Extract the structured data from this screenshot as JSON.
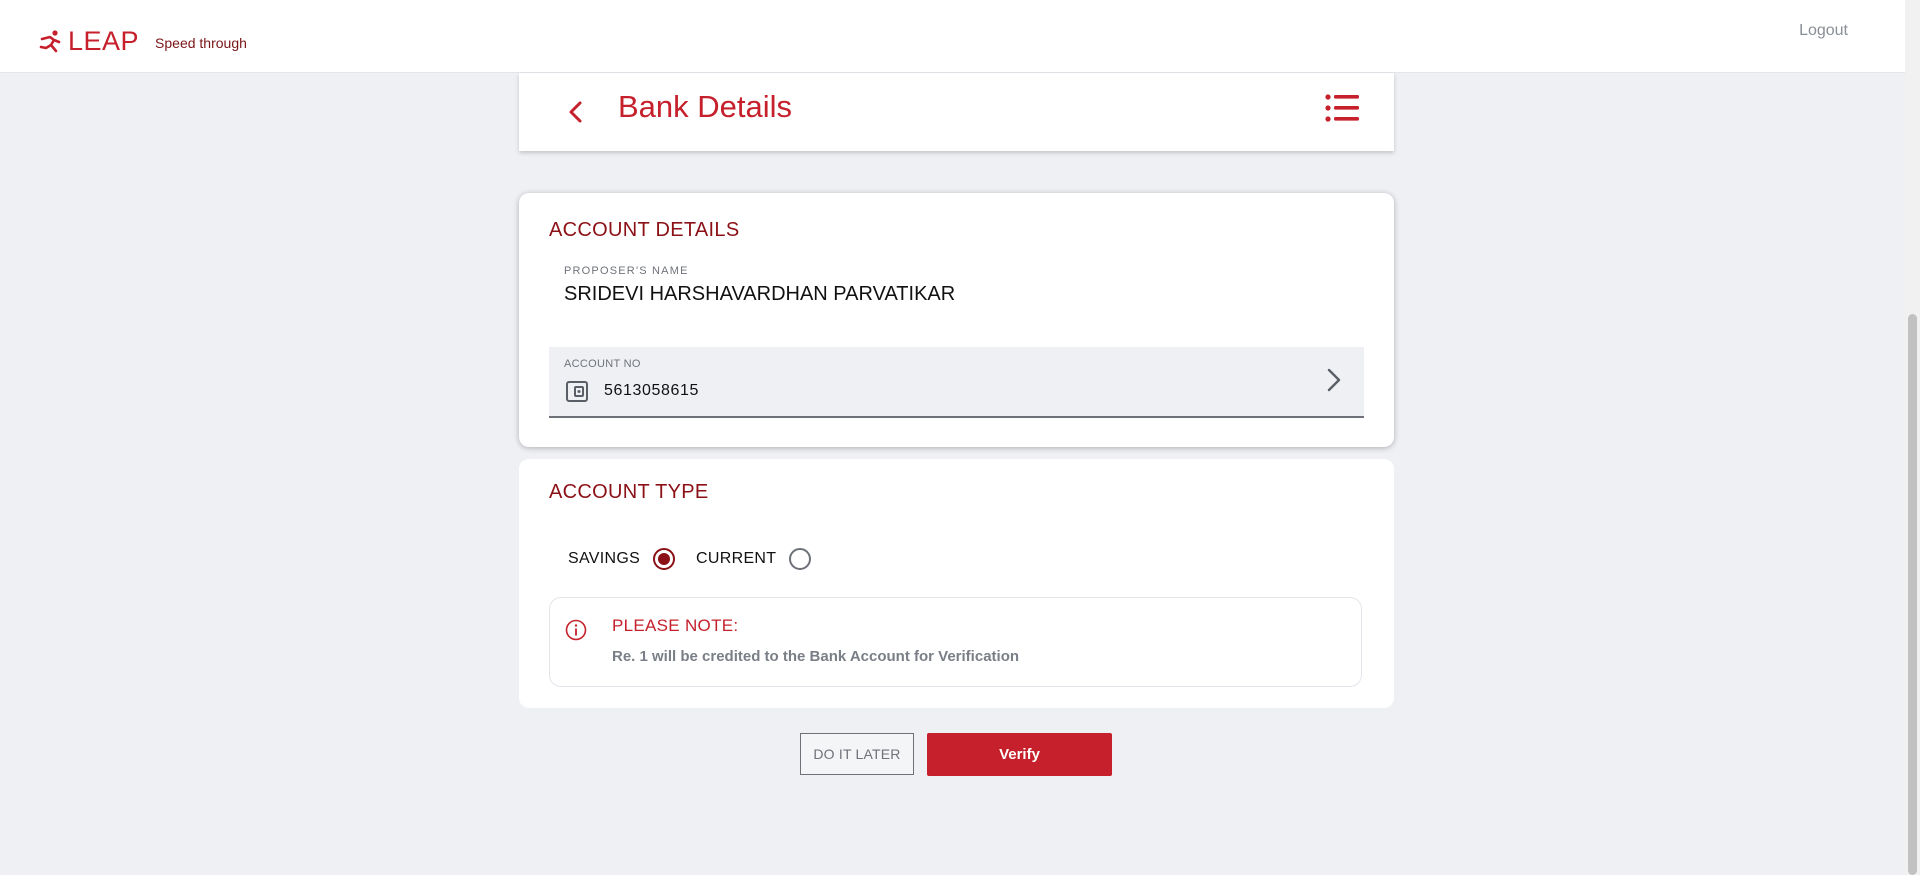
{
  "header": {
    "brand_name": "LEAP",
    "tagline": "Speed through",
    "logout_label": "Logout",
    "accent_color": "#c5202b"
  },
  "page": {
    "title": "Bank Details",
    "back_icon": "chevron-left-icon",
    "menu_icon": "list-icon"
  },
  "account_details": {
    "section_title": "ACCOUNT DETAILS",
    "proposer_label": "PROPOSER'S NAME",
    "proposer_name": "SRIDEVI HARSHAVARDHAN PARVATIKAR",
    "account_label": "ACCOUNT NO",
    "account_number": "5613058615",
    "account_icon": "wallet-icon"
  },
  "account_type": {
    "section_title": "ACCOUNT TYPE",
    "options": [
      {
        "label": "SAVINGS",
        "selected": true
      },
      {
        "label": "CURRENT",
        "selected": false
      }
    ],
    "note_title": "PLEASE NOTE:",
    "note_text": "Re. 1 will be credited to the Bank Account for Verification"
  },
  "actions": {
    "later_label": "DO IT LATER",
    "verify_label": "Verify"
  }
}
